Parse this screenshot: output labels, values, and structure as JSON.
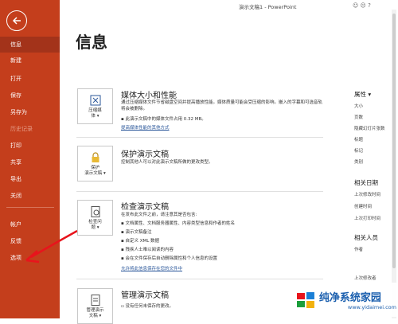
{
  "window": {
    "title": "演示文稿1 - PowerPoint"
  },
  "sidebar": {
    "items": [
      {
        "label": "信息",
        "active": true
      },
      {
        "label": "新建"
      },
      {
        "label": "打开"
      },
      {
        "label": "保存"
      },
      {
        "label": "另存为"
      },
      {
        "label": "历史记录",
        "disabled": true
      },
      {
        "label": "打印"
      },
      {
        "label": "共享"
      },
      {
        "label": "导出"
      },
      {
        "label": "关闭"
      },
      {
        "label": "帐户"
      },
      {
        "label": "反馈"
      },
      {
        "label": "选项"
      }
    ]
  },
  "page": {
    "title": "信息"
  },
  "media": {
    "title": "媒体大小和性能",
    "desc": "通过压缩媒体文件节省磁盘空间并提高播放性能。媒体质量可能会受压缩的影响。嵌入的字幕和可选音轨将会被删除。",
    "bullet": "此演示文稿中的媒体文件占用 0.32 MB。",
    "link": "提高媒体性能的其他方式",
    "card_label": "压缩媒\n体 ▾"
  },
  "protect": {
    "title": "保护演示文稿",
    "desc": "控制其他人可以对此演示文稿所做的更改类型。",
    "card_label": "保护\n演示文稿 ▾"
  },
  "inspect": {
    "title": "检查演示文稿",
    "desc": "在发布此文件之前，请注意其是否包含:",
    "bullets": [
      "文档属性、文档服务器属性、内容类型信息和作者的姓名",
      "演示文稿备注",
      "自定义 XML 数据",
      "残疾人士难以阅读的内容",
      "会在文件保存后自动删除属性和个人信息的设置"
    ],
    "link": "允许将此信息保存在您的文件中",
    "card_label": "检查问\n题 ▾"
  },
  "manage": {
    "title": "管理演示文稿",
    "desc": "没有任何未保存的更改。",
    "card_label": "管理演示\n文稿 ▾"
  },
  "properties": {
    "heading": "属性 ▾",
    "items": [
      "大小",
      "页数",
      "隐藏幻灯片张数",
      "标题",
      "标记",
      "类别"
    ],
    "dates_heading": "相关日期",
    "dates": [
      "上次修改时间",
      "创建时间",
      "上次打印时间"
    ],
    "people_heading": "相关人员",
    "people": [
      "作者"
    ],
    "last_modified": "上次修改者"
  },
  "watermark": {
    "text": "纯净系统家园",
    "url": "www.yidaimei.com"
  },
  "colors": {
    "sidebar": "#c43e1c",
    "accent_link": "#2b579a",
    "arrow": "#e8141c"
  }
}
